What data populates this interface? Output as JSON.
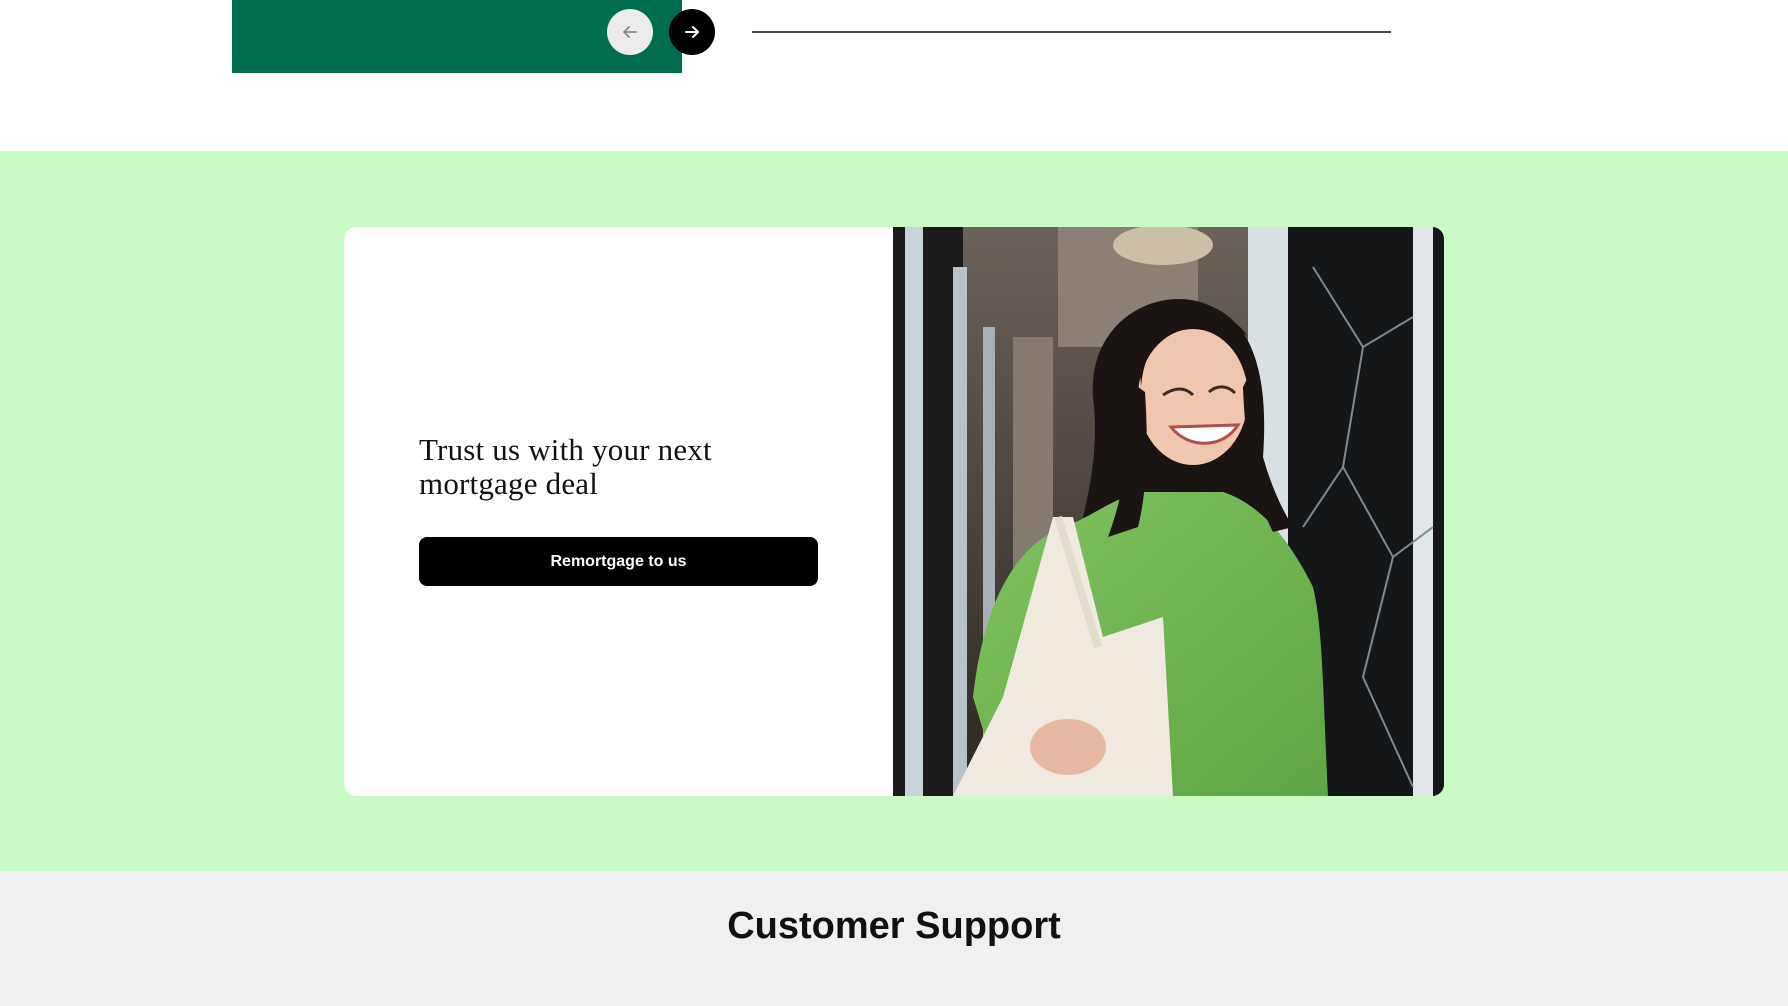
{
  "carousel": {
    "card_color": "#006d4e",
    "prev_icon": "arrow-left-icon",
    "next_icon": "arrow-right-icon"
  },
  "promo": {
    "background_color": "#c9fcc5",
    "heading_line1": "Trust us with your next",
    "heading_line2": "mortgage deal",
    "button_label": "Remortgage to us",
    "image_icon": "woman-with-tote-bag-photo"
  },
  "support": {
    "title": "Customer Support"
  }
}
